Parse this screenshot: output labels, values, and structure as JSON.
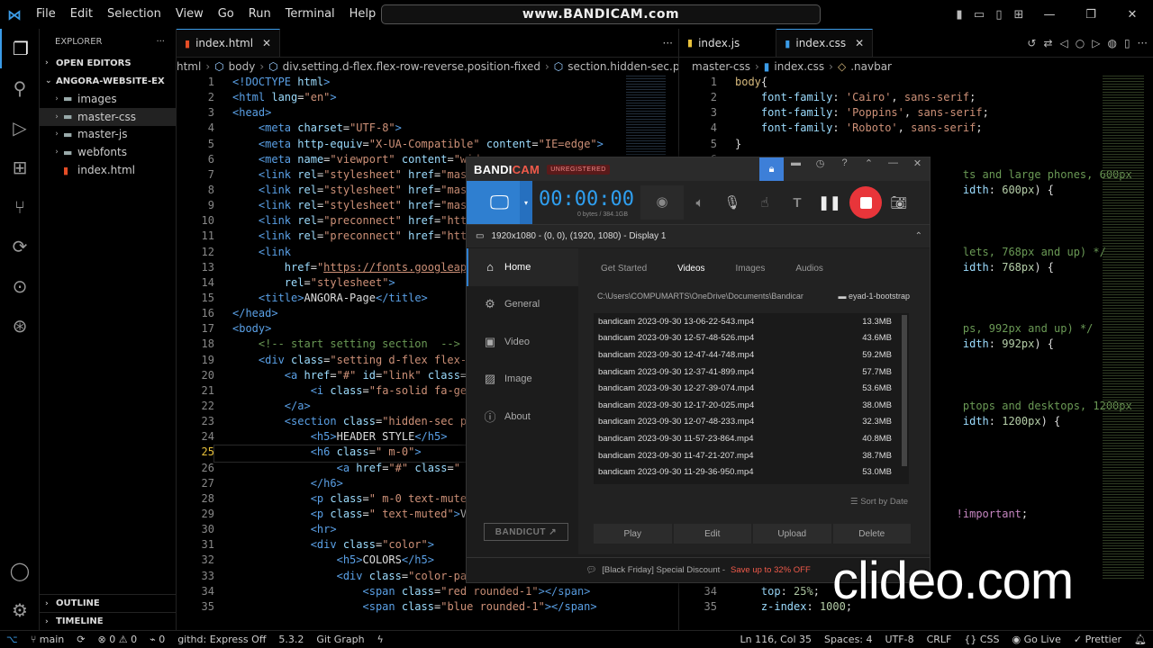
{
  "titlebar": {
    "menu": [
      "File",
      "Edit",
      "Selection",
      "View",
      "Go",
      "Run",
      "Terminal",
      "Help"
    ],
    "search_text": "www.BANDICAM.com"
  },
  "sidebar": {
    "header": "EXPLORER",
    "open_editors": "OPEN EDITORS",
    "project": "ANGORA-WEBSITE-EX",
    "items": [
      {
        "label": "images",
        "type": "folder"
      },
      {
        "label": "master-css",
        "type": "folder"
      },
      {
        "label": "master-js",
        "type": "folder"
      },
      {
        "label": "webfonts",
        "type": "folder"
      },
      {
        "label": "index.html",
        "type": "html"
      }
    ],
    "outline": "OUTLINE",
    "timeline": "TIMELINE"
  },
  "left_editor": {
    "tab": "index.html",
    "breadcrumb": [
      "html",
      "body",
      "div.setting.d-flex.flex-row-reverse.position-fixed",
      "section.hidden-sec.p-3.bg-light"
    ],
    "current_line": 25
  },
  "right_editor": {
    "tabs": [
      "index.js",
      "index.css"
    ],
    "breadcrumb": [
      "master-css",
      "index.css",
      ".navbar"
    ]
  },
  "statusbar": {
    "branch": "main",
    "errors": "0",
    "warnings": "0",
    "ports": "0",
    "githd": "githd: Express Off",
    "version": "5.3.2",
    "git_graph": "Git Graph",
    "position": "Ln 116, Col 35",
    "spaces": "Spaces: 4",
    "encoding": "UTF-8",
    "eol": "CRLF",
    "language": "CSS",
    "go_live": "Go Live",
    "prettier": "Prettier"
  },
  "bandicam": {
    "logo_a": "BANDI",
    "logo_b": "CAM",
    "unregistered": "UNREGISTERED",
    "timer": "00:00:00",
    "size": "0 bytes / 384.1GB",
    "resolution": "1920x1080 - (0, 0), (1920, 1080) - Display 1",
    "nav": [
      "Home",
      "General",
      "Video",
      "Image",
      "About"
    ],
    "tabs": [
      "Get Started",
      "Videos",
      "Images",
      "Audios"
    ],
    "path": "C:\\Users\\COMPUMARTS\\OneDrive\\Documents\\Bandicar",
    "folder": "eyad-1-bootstrap",
    "files": [
      {
        "name": "bandicam 2023-09-30 13-06-22-543.mp4",
        "size": "13.3MB"
      },
      {
        "name": "bandicam 2023-09-30 12-57-48-526.mp4",
        "size": "43.6MB"
      },
      {
        "name": "bandicam 2023-09-30 12-47-44-748.mp4",
        "size": "59.2MB"
      },
      {
        "name": "bandicam 2023-09-30 12-37-41-899.mp4",
        "size": "57.7MB"
      },
      {
        "name": "bandicam 2023-09-30 12-27-39-074.mp4",
        "size": "53.6MB"
      },
      {
        "name": "bandicam 2023-09-30 12-17-20-025.mp4",
        "size": "38.0MB"
      },
      {
        "name": "bandicam 2023-09-30 12-07-48-233.mp4",
        "size": "32.3MB"
      },
      {
        "name": "bandicam 2023-09-30 11-57-23-864.mp4",
        "size": "40.8MB"
      },
      {
        "name": "bandicam 2023-09-30 11-47-21-207.mp4",
        "size": "38.7MB"
      },
      {
        "name": "bandicam 2023-09-30 11-29-36-950.mp4",
        "size": "53.0MB"
      }
    ],
    "sort": "Sort by Date",
    "actions": [
      "Play",
      "Edit",
      "Upload",
      "Delete"
    ],
    "bandicut": "BANDICUT",
    "footer_a": "[Black Friday] Special Discount - ",
    "footer_b": "Save up to 32% OFF"
  },
  "watermark": "clideo.com"
}
